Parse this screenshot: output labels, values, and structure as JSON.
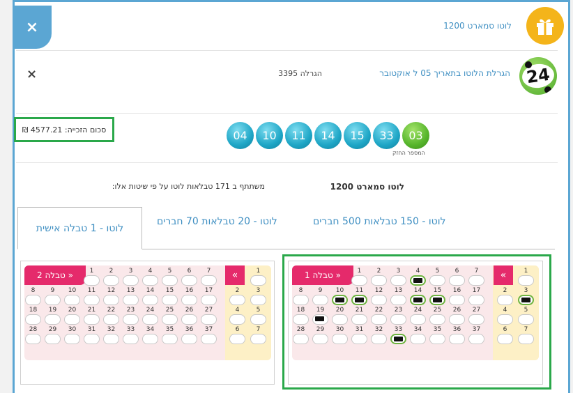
{
  "header": {
    "close_label": "×",
    "product_title": "לוטו סמארט 1200"
  },
  "draw": {
    "date_text": "הגרלת הלוטו בתאריך 05 ל אוקטובר",
    "number_text": "הגרלה 3395",
    "close_label": "×",
    "logo_number": "24"
  },
  "prize": {
    "text": "סכום הזכייה: 4577.21 ₪"
  },
  "results": {
    "balls": [
      "04",
      "10",
      "11",
      "14",
      "15",
      "33"
    ],
    "strong_ball": "03",
    "strong_label": "המספר החזק"
  },
  "package": {
    "name": "לוטו סמארט 1200",
    "description": "משתתף ב 171 טבלאות לוטו על פי שיטות אלו:"
  },
  "tabs": [
    {
      "label": "לוטו - 1 טבלה אישית"
    },
    {
      "label": "לוטו - 20 טבלאות 70 חברים"
    },
    {
      "label": "לוטו - 150 טבלאות 500 חברים"
    }
  ],
  "tables": [
    {
      "label": "טבלה 1",
      "chevron": "«",
      "selected": [
        4,
        10,
        11,
        14,
        15,
        33
      ],
      "selected_plain": [
        19
      ],
      "strong_selected": [
        3
      ]
    },
    {
      "label": "טבלה 2",
      "chevron": "«",
      "selected": [],
      "selected_plain": [],
      "strong_selected": []
    }
  ],
  "colors": {
    "accent": "#5ba6d3",
    "highlight": "#2aa84a",
    "pink": "#e52a6b",
    "gift": "#f4b41a"
  }
}
